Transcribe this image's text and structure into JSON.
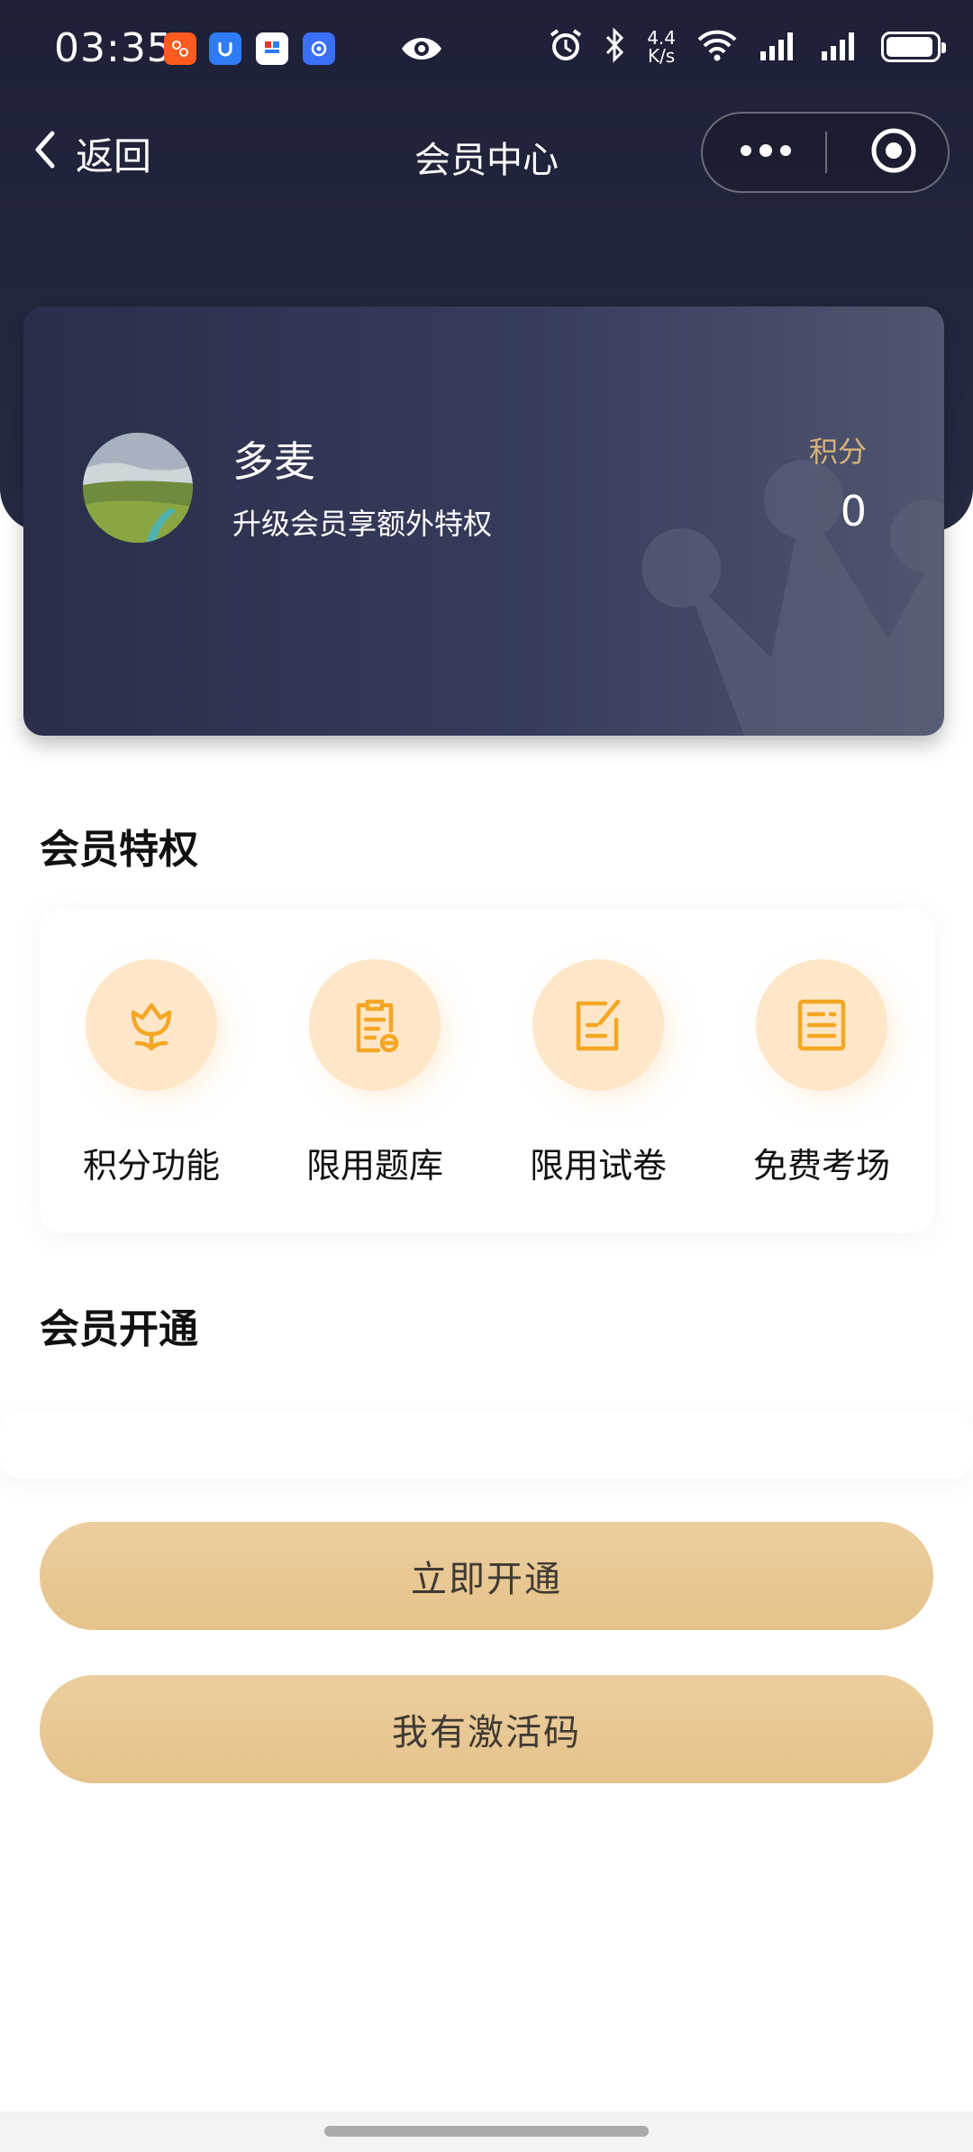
{
  "status_bar": {
    "time": "03:35",
    "net_speed_top": "4.4",
    "net_speed_bottom": "K/s",
    "battery_level": 0.95,
    "icons": [
      "app-notification-icon",
      "app-notification-icon",
      "app-notification-icon",
      "app-notification-icon",
      "eye-icon",
      "alarm-icon",
      "bluetooth-icon",
      "wifi-icon",
      "signal-icon",
      "signal-icon",
      "battery-icon"
    ]
  },
  "nav": {
    "back_label": "返回",
    "title": "会员中心"
  },
  "member_card": {
    "name": "多麦",
    "subtitle": "升级会员享额外特权",
    "points_label": "积分",
    "points_value": "0"
  },
  "privileges": {
    "title": "会员特权",
    "items": [
      {
        "label": "积分功能",
        "icon": "flower-icon"
      },
      {
        "label": "限用题库",
        "icon": "clipboard-icon"
      },
      {
        "label": "限用试卷",
        "icon": "edit-icon"
      },
      {
        "label": "免费考场",
        "icon": "document-icon"
      }
    ]
  },
  "membership": {
    "title": "会员开通"
  },
  "buttons": {
    "activate_now": "立即开通",
    "activation_code": "我有激活码"
  },
  "colors": {
    "header_dark": "#1d2036",
    "gold": "#e5c28a",
    "points_label": "#d9b27a",
    "icon_orange": "#f5a623",
    "icon_bg": "#fde7c8"
  }
}
